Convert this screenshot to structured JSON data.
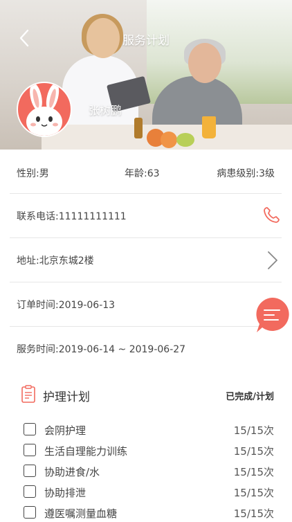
{
  "header": {
    "title": "服务计划",
    "user_name": "张树鹏"
  },
  "patient": {
    "gender": "性别:男",
    "age": "年龄:63",
    "level": "病患级别:3级",
    "phone": "联系电话:11111111111",
    "address": "地址:北京东城2楼",
    "order_time": "订单时间:2019-06-13",
    "service_time": "服务时间:2019-06-14 ~ 2019-06-27"
  },
  "plan": {
    "title": "护理计划",
    "status_label": "已完成/计划",
    "items": [
      {
        "name": "会阴护理",
        "count": "15/15次"
      },
      {
        "name": "生活自理能力训练",
        "count": "15/15次"
      },
      {
        "name": "协助进食/水",
        "count": "15/15次"
      },
      {
        "name": "协助排泄",
        "count": "15/15次"
      },
      {
        "name": "遵医嘱测量血糖",
        "count": "15/15次"
      }
    ]
  },
  "colors": {
    "accent": "#f26a5e",
    "text": "#444444",
    "divider": "#e6e6e6"
  },
  "icons": {
    "back": "chevron-left-icon",
    "phone": "phone-icon",
    "address_arrow": "chevron-right-icon",
    "fab": "menu-lines-icon",
    "plan": "clipboard-icon",
    "avatar": "rabbit-avatar"
  }
}
